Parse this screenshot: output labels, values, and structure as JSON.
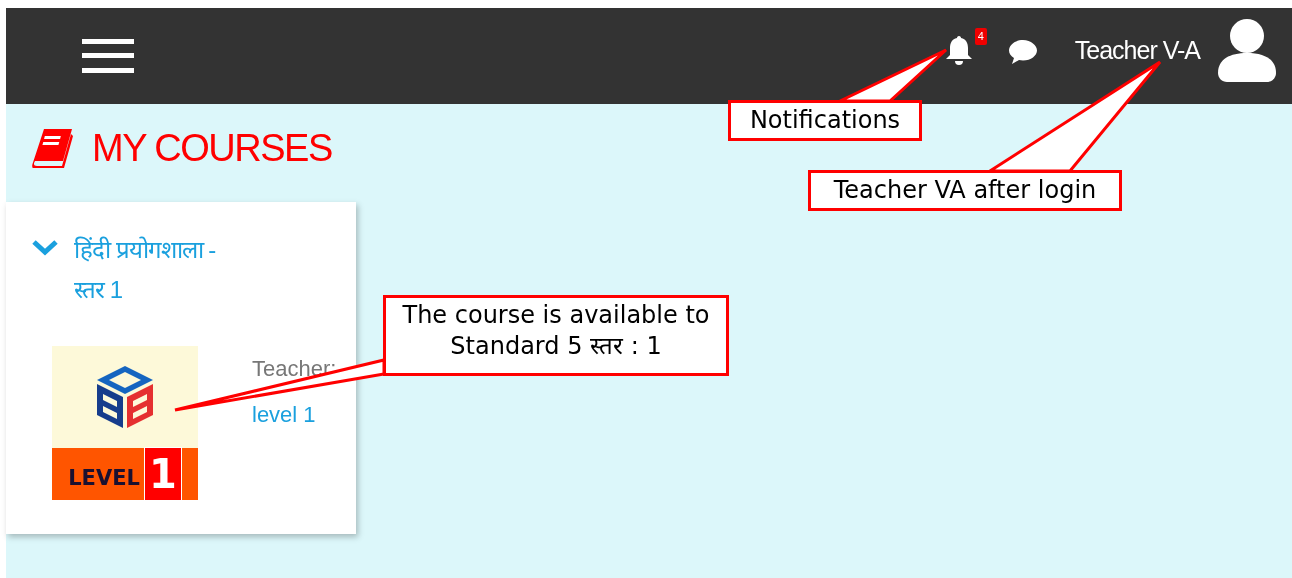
{
  "header": {
    "notification_count": "4",
    "user_name": "Teacher V-A"
  },
  "page_title": "MY COURSES",
  "courses": [
    {
      "title": "हिंदी प्रयोगशाला - स्तर 1",
      "expanded": true,
      "thumbnail": {
        "badge_label": "LEVEL",
        "badge_number": "1"
      },
      "teacher_label": "Teacher:",
      "level": "level 1"
    }
  ],
  "callouts": [
    {
      "text": "Notifications"
    },
    {
      "text": "Teacher VA after login"
    },
    {
      "text": "The course is available to Standard 5  स्तर : 1"
    }
  ]
}
